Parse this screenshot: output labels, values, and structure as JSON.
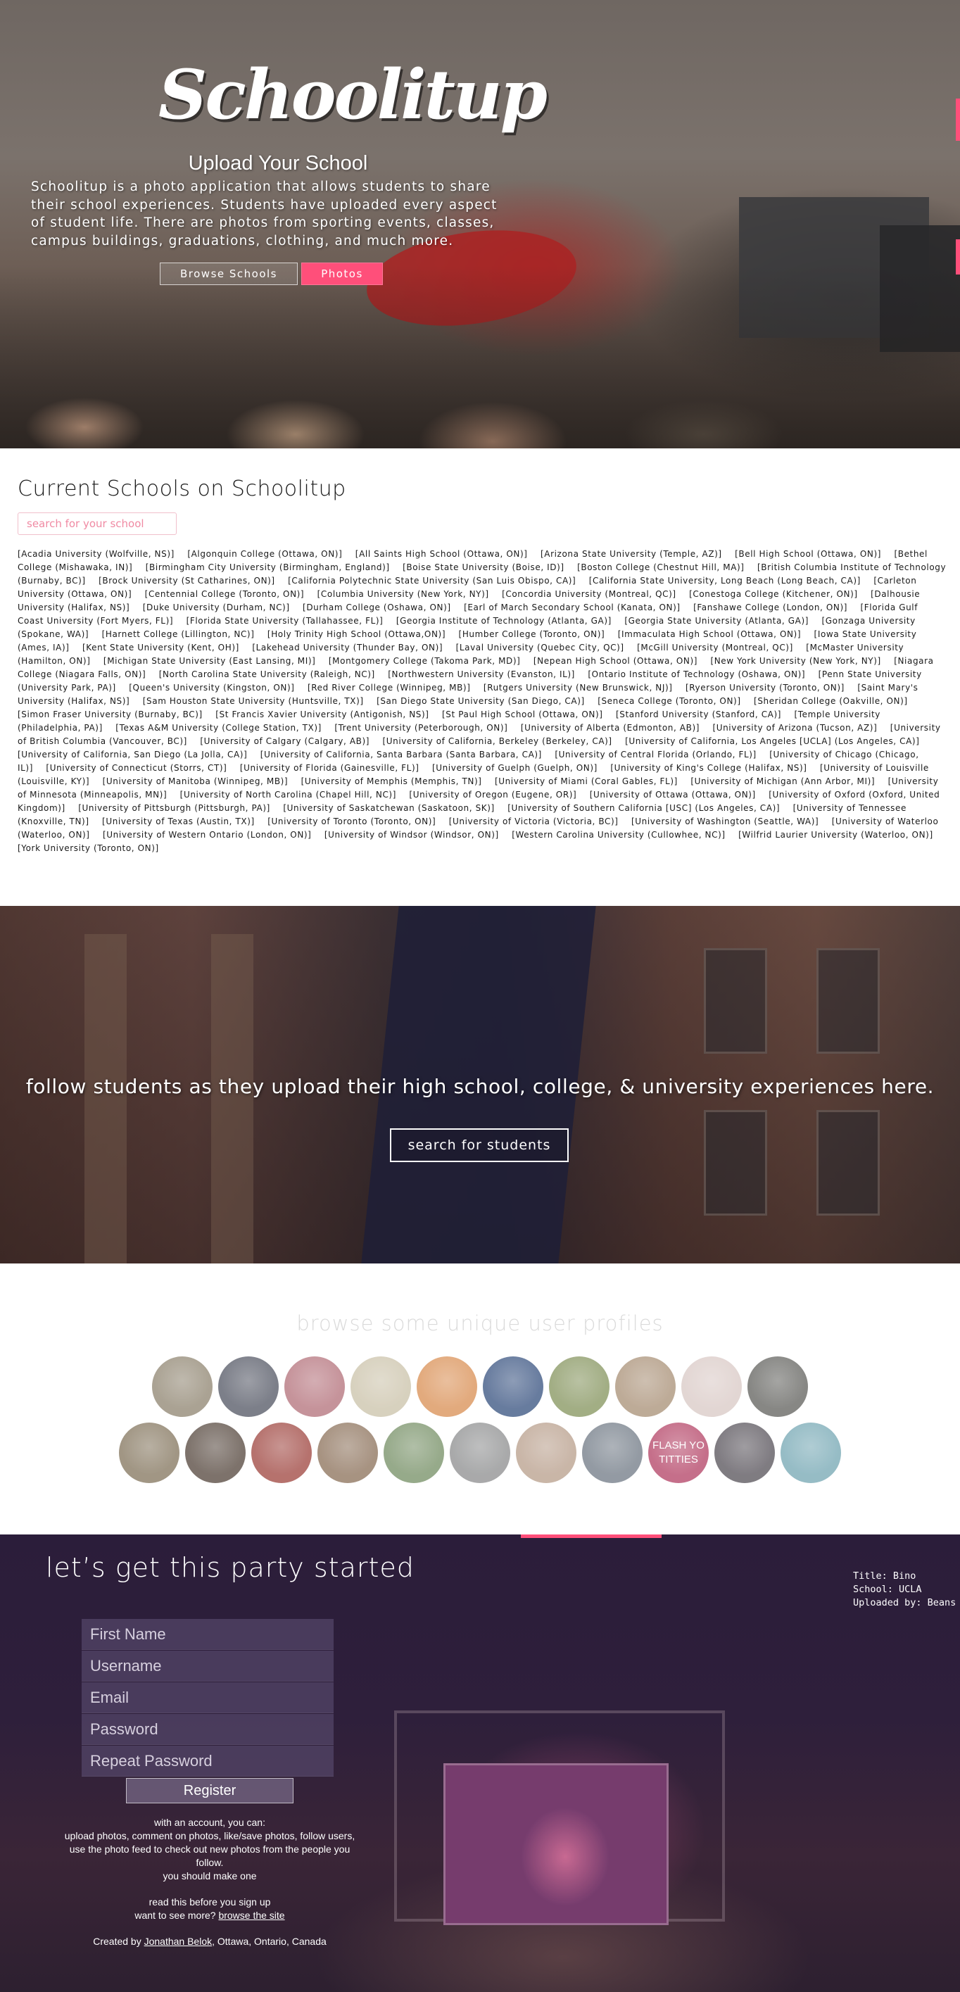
{
  "hero": {
    "brand": "Schoolitup",
    "upload_title": "Upload Your School",
    "description": "Schoolitup is a photo application that allows students to share their school experiences. Students have uploaded every aspect of student life. There are photos from sporting events, classes, campus buildings, graduations, clothing, and much more.",
    "browse_button": "Browse Schools",
    "photos_button": "Photos",
    "accent": "#ff4f7a"
  },
  "schools": {
    "title": "Current Schools on Schoolitup",
    "search_placeholder": "search for your school",
    "list": [
      "Acadia University (Wolfville, NS)",
      "Algonquin College (Ottawa, ON)",
      "All Saints High School (Ottawa, ON)",
      "Arizona State University (Temple, AZ)",
      "Bell High School (Ottawa, ON)",
      "Bethel College (Mishawaka, IN)",
      "Birmingham City University (Birmingham, England)",
      "Boise State University (Boise, ID)",
      "Boston College (Chestnut Hill, MA)",
      "British Columbia Institute of Technology (Burnaby, BC)",
      "Brock University (St Catharines, ON)",
      "California Polytechnic State University (San Luis Obispo, CA)",
      "California State University, Long Beach (Long Beach, CA)",
      "Carleton University (Ottawa, ON)",
      "Centennial College (Toronto, ON)",
      "Columbia University (New York, NY)",
      "Concordia University (Montreal, QC)",
      "Conestoga College (Kitchener, ON)",
      "Dalhousie University (Halifax, NS)",
      "Duke University (Durham, NC)",
      "Durham College (Oshawa, ON)",
      "Earl of March Secondary School (Kanata, ON)",
      "Fanshawe College (London, ON)",
      "Florida Gulf Coast University (Fort Myers, FL)",
      "Florida State University (Tallahassee, FL)",
      "Georgia Institute of Technology (Atlanta, GA)",
      "Georgia State University (Atlanta, GA)",
      "Gonzaga University (Spokane, WA)",
      "Harnett College (Lillington, NC)",
      "Holy Trinity High School (Ottawa,ON)",
      "Humber College (Toronto, ON)",
      "Immaculata High School (Ottawa, ON)",
      "Iowa State University (Ames, IA)",
      "Kent State University (Kent, OH)",
      "Lakehead University (Thunder Bay, ON)",
      "Laval University (Quebec City, QC)",
      "McGill University (Montreal, QC)",
      "McMaster University (Hamilton, ON)",
      "Michigan State University (East Lansing, MI)",
      "Montgomery College (Takoma Park, MD)",
      "Nepean High School (Ottawa, ON)",
      "New York University (New York, NY)",
      "Niagara College (Niagara Falls, ON)",
      "North Carolina State University (Raleigh, NC)",
      "Northwestern University (Evanston, IL)",
      "Ontario Institute of Technology (Oshawa, ON)",
      "Penn State University (University Park, PA)",
      "Queen's University (Kingston, ON)",
      "Red River College (Winnipeg, MB)",
      "Rutgers University (New Brunswick, NJ)",
      "Ryerson University (Toronto, ON)",
      "Saint Mary's University (Halifax, NS)",
      "Sam Houston State University (Huntsville, TX)",
      "San Diego State University (San Diego, CA)",
      "Seneca College (Toronto, ON)",
      "Sheridan College (Oakville, ON)",
      "Simon Fraser University (Burnaby, BC)",
      "St Francis Xavier University (Antigonish, NS)",
      "St Paul High School (Ottawa, ON)",
      "Stanford University (Stanford, CA)",
      "Temple University (Philadelphia, PA)",
      "Texas A&M University (College Station, TX)",
      "Trent University (Peterborough, ON)",
      "University of Alberta (Edmonton, AB)",
      "University of Arizona (Tucson, AZ)",
      "University of British Columbia (Vancouver, BC)",
      "University of Calgary (Calgary, AB)",
      "University of California, Berkeley (Berkeley, CA)",
      "University of California, Los Angeles [UCLA] (Los Angeles, CA)",
      "University of California, San Diego (La Jolla, CA)",
      "University of California, Santa Barbara (Santa Barbara, CA)",
      "University of Central Florida (Orlando, FL)",
      "University of Chicago (Chicago, IL)",
      "University of Connecticut (Storrs, CT)",
      "University of Florida (Gainesville, FL)",
      "University of Guelph (Guelph, ON)",
      "University of King's College (Halifax, NS)",
      "University of Louisville (Louisville, KY)",
      "University of Manitoba (Winnipeg, MB)",
      "University of Memphis (Memphis, TN)",
      "University of Miami (Coral Gables, FL)",
      "University of Michigan (Ann Arbor, MI)",
      "University of Minnesota (Minneapolis, MN)",
      "University of North Carolina (Chapel Hill, NC)",
      "University of Oregon (Eugene, OR)",
      "University of Ottawa (Ottawa, ON)",
      "University of Oxford (Oxford, United Kingdom)",
      "University of Pittsburgh (Pittsburgh, PA)",
      "University of Saskatchewan (Saskatoon, SK)",
      "University of Southern California [USC] (Los Angeles, CA)",
      "University of Tennessee (Knoxville, TN)",
      "University of Texas (Austin, TX)",
      "University of Toronto (Toronto, ON)",
      "University of Victoria (Victoria, BC)",
      "University of Washington (Seattle, WA)",
      "University of Waterloo (Waterloo, ON)",
      "University of Western Ontario (London, ON)",
      "University of Windsor (Windsor, ON)",
      "Western Carolina University (Cullowhee, NC)",
      "Wilfrid Laurier University (Waterloo, ON)",
      "York University (Toronto, ON)"
    ]
  },
  "follow": {
    "text": "follow students as they upload their high school, college, & university experiences here.",
    "button": "search for students"
  },
  "profiles": {
    "title": "browse some unique user profiles",
    "row1": [
      {
        "name": "profile-avatar",
        "color": "#8a7f6a",
        "label": ""
      },
      {
        "name": "profile-avatar",
        "color": "#4a4e5c",
        "label": ""
      },
      {
        "name": "profile-avatar",
        "color": "#b06a74",
        "label": ""
      },
      {
        "name": "profile-avatar",
        "color": "#c9c0a6",
        "label": ""
      },
      {
        "name": "profile-avatar",
        "color": "#d88a4c",
        "label": ""
      },
      {
        "name": "profile-avatar",
        "color": "#2e4a7a",
        "label": ""
      },
      {
        "name": "profile-avatar",
        "color": "#7f8f56",
        "label": ""
      },
      {
        "name": "profile-avatar",
        "color": "#a58b70",
        "label": ""
      },
      {
        "name": "profile-avatar",
        "color": "#d8c7c3",
        "label": ""
      },
      {
        "name": "profile-avatar",
        "color": "#5a5a56",
        "label": ""
      }
    ],
    "row2": [
      {
        "name": "profile-avatar",
        "color": "#7d6e55",
        "label": ""
      },
      {
        "name": "profile-avatar",
        "color": "#4c3d33",
        "label": ""
      },
      {
        "name": "profile-avatar",
        "color": "#9a3c36",
        "label": ""
      },
      {
        "name": "profile-avatar",
        "color": "#866a52",
        "label": ""
      },
      {
        "name": "profile-avatar",
        "color": "#6f8a5e",
        "label": ""
      },
      {
        "name": "profile-avatar",
        "color": "#88898a",
        "label": ""
      },
      {
        "name": "profile-avatar",
        "color": "#b59a86",
        "label": ""
      },
      {
        "name": "profile-avatar",
        "color": "#6a7480",
        "label": ""
      },
      {
        "name": "profile-avatar",
        "color": "#b0395e",
        "label": "FLASH YO TITTIES"
      },
      {
        "name": "profile-avatar",
        "color": "#4f4a52",
        "label": ""
      },
      {
        "name": "profile-avatar",
        "color": "#6ea3b0",
        "label": ""
      }
    ]
  },
  "register": {
    "title": "let’s get this party started",
    "first_name_placeholder": "First Name",
    "username_placeholder": "Username",
    "email_placeholder": "Email",
    "password_placeholder": "Password",
    "repeat_password_placeholder": "Repeat Password",
    "button": "Register",
    "info_line1": "with an account, you can:",
    "info_line2": "upload photos, comment on photos, like/save photos, follow users, use the photo feed to check out new photos from the people you follow.",
    "info_line3": "you should make one",
    "read_before": "read this before you sign up",
    "see_more_prefix": "want to see more?",
    "see_more_link": "browse the site",
    "created_prefix": "Created by",
    "created_author": "Jonathan Belok",
    "created_location": ", Ottawa, Ontario, Canada"
  },
  "photo_meta": {
    "title": "Title: Bino",
    "school": "School: UCLA",
    "uploaded_by": "Uploaded by: Beans"
  }
}
